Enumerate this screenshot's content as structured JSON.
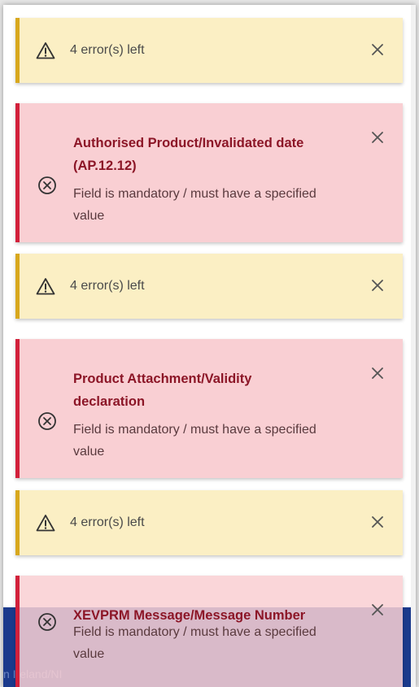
{
  "footer": {
    "text": "n Ireland/NI"
  },
  "toasts": [
    {
      "type": "warning",
      "message": "4 error(s) left"
    },
    {
      "type": "error",
      "title": "Authorised Product/Invalidated date (AP.12.12)",
      "message": "Field is mandatory / must have a specified value"
    },
    {
      "type": "warning",
      "message": "4 error(s) left"
    },
    {
      "type": "error",
      "title": "Product Attachment/Validity declaration",
      "message": "Field is mandatory / must have a specified value"
    },
    {
      "type": "warning",
      "message": "4 error(s) left"
    },
    {
      "type": "error",
      "title": "XEVPRM Message/Message Number",
      "message": "Field is mandatory / must have a specified value"
    }
  ],
  "colors": {
    "warning_bg": "#fbefc4",
    "warning_accent": "#d8a81e",
    "error_bg": "#f9cfd3",
    "error_accent": "#d2203b",
    "error_title": "#8c1627",
    "footer_bg": "#1b3a8c"
  },
  "icons": {
    "warning": "warning-triangle-icon",
    "error": "error-circle-x-icon",
    "close": "close-icon"
  }
}
